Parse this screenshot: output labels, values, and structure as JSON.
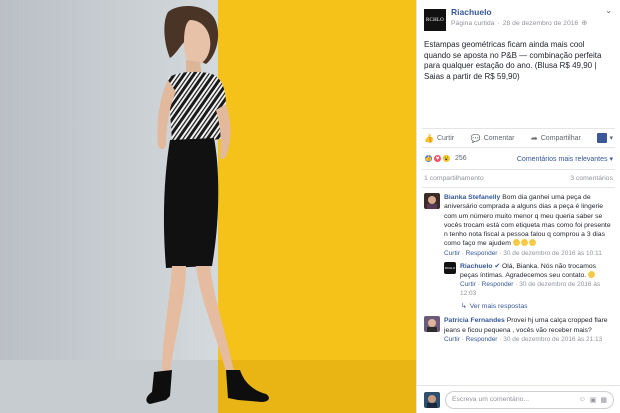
{
  "page": {
    "name": "Riachuelo",
    "logo_text": "RCHLO",
    "meta_label": "Página curtida",
    "date": "28 de dezembro de 2016",
    "globe_icon": "globe-icon"
  },
  "post": {
    "text": "Estampas geométricas ficam ainda mais cool quando se aposta no P&B — combinação perfeita para qualquer estação do ano. (Blusa R$ 49,90 | Saias a partir de R$ 59,90)"
  },
  "actions": {
    "like": "Curtir",
    "comment": "Comentar",
    "share": "Compartilhar"
  },
  "reactions": {
    "count": "256",
    "filter": "Comentários mais relevantes",
    "colors": {
      "like": "#4080ff",
      "love": "#f25268",
      "wow": "#f7c948"
    }
  },
  "counts": {
    "shares": "1 compartilhamento",
    "comments": "3 comentários"
  },
  "comments": [
    {
      "author": "Bianka Stefanelly",
      "text": "Bom dia ganhei uma peça de aniversário comprada a alguns dias a peça é lingerie com um número muito menor q meu queria saber se vocês trocam está com etiqueta mas como foi presente n tenho nota fiscal a pessoa falou q comprou a 3 dias como faço me ajudem",
      "action_like": "Curtir",
      "action_reply": "Responder",
      "time": "30 de dezembro de 2016 às 10:11"
    },
    {
      "author": "Riachuelo",
      "text": "Olá, Bianka. Nós não trocamos peças íntimas. Agradecemos seu contato.",
      "action_like": "Curtir",
      "action_reply": "Responder",
      "time": "30 de dezembro de 2016 às 12:03"
    },
    {
      "author": "Patrícia Fernandes",
      "text": "Provei hj uma calça cropped flare jeans e ficou pequena , vocês vão receber mais?",
      "action_like": "Curtir",
      "action_reply": "Responder",
      "time": "30 de dezembro de 2016 às 21:13"
    }
  ],
  "more_replies": "Ver mais respostas",
  "composer": {
    "placeholder": "Escreva um comentário..."
  },
  "colors": {
    "link": "#365899",
    "photo_left_bg": "#c9cfd3",
    "photo_right_bg": "#f4c21b"
  }
}
